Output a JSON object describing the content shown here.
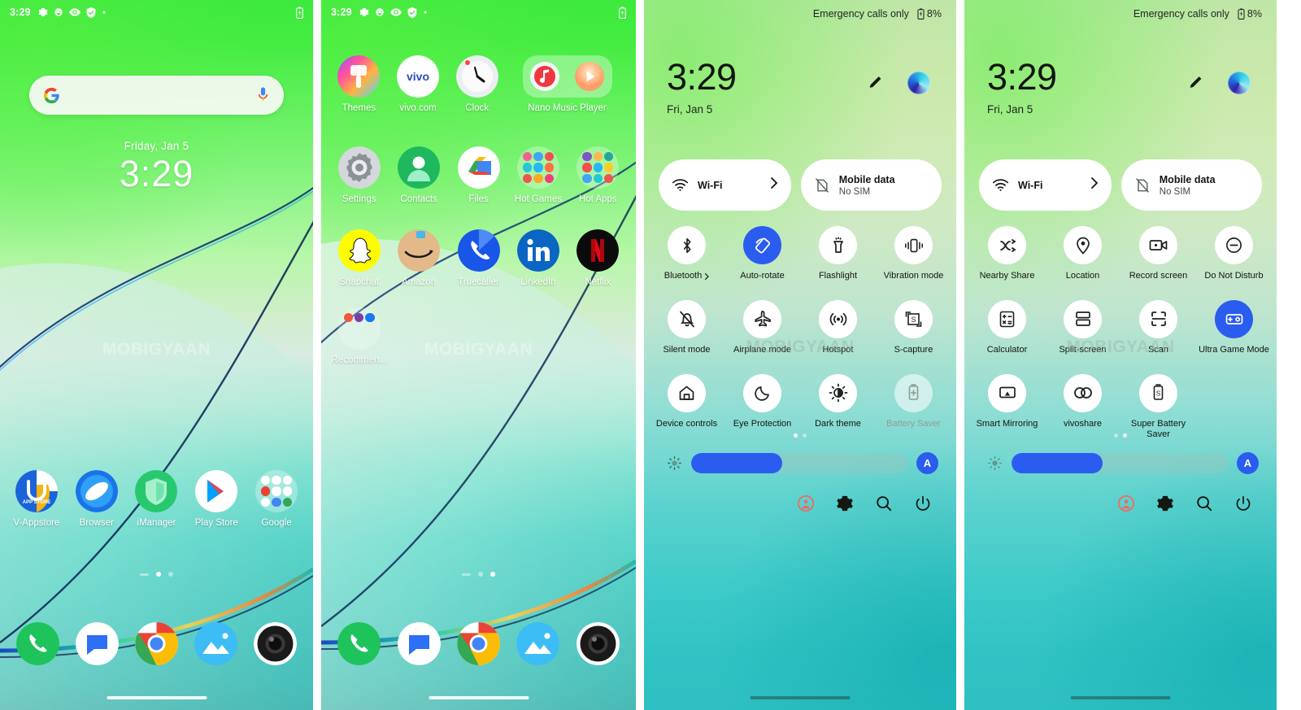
{
  "watermark": "MOBIGYAAN",
  "statusbar": {
    "time": "3:29",
    "icons": [
      "gear-icon",
      "face-icon",
      "eye-icon",
      "shield-icon",
      "dot-icon"
    ],
    "battery": "battery-charging-icon"
  },
  "home": {
    "search_placeholder": "",
    "google_icon": "google-g-icon",
    "mic_icon": "microphone-icon",
    "date": "Friday, Jan 5",
    "time": "3:29",
    "apps": [
      {
        "label": "V-Appstore",
        "icon": "v-appstore-icon"
      },
      {
        "label": "Browser",
        "icon": "browser-icon"
      },
      {
        "label": "iManager",
        "icon": "imanager-icon"
      },
      {
        "label": "Play Store",
        "icon": "play-store-icon"
      },
      {
        "label": "Google",
        "icon": "google-folder-icon"
      }
    ],
    "dock": [
      {
        "label": "Phone",
        "icon": "phone-icon"
      },
      {
        "label": "Messages",
        "icon": "messages-icon"
      },
      {
        "label": "Chrome",
        "icon": "chrome-icon"
      },
      {
        "label": "Gallery",
        "icon": "gallery-icon"
      },
      {
        "label": "Camera",
        "icon": "camera-icon"
      }
    ],
    "page_indicator": {
      "pages": 3,
      "active": 1
    }
  },
  "home2": {
    "row1": [
      {
        "label": "Themes",
        "icon": "themes-icon"
      },
      {
        "label": "vivo.com",
        "icon": "vivo-icon"
      },
      {
        "label": "Clock",
        "icon": "clock-icon"
      },
      {
        "label": "Nano Music Player",
        "icon": "nano-music-player-widget"
      }
    ],
    "row2": [
      {
        "label": "Settings",
        "icon": "settings-gear-icon"
      },
      {
        "label": "Contacts",
        "icon": "contacts-icon"
      },
      {
        "label": "Files",
        "icon": "files-icon"
      },
      {
        "label": "Hot Games",
        "icon": "hot-games-folder-icon"
      },
      {
        "label": "Hot Apps",
        "icon": "hot-apps-folder-icon"
      }
    ],
    "row3": [
      {
        "label": "Snapchat",
        "icon": "snapchat-icon"
      },
      {
        "label": "Amazon",
        "icon": "amazon-icon"
      },
      {
        "label": "Truecaller",
        "icon": "truecaller-icon"
      },
      {
        "label": "LinkedIn",
        "icon": "linkedin-icon"
      },
      {
        "label": "Netflix",
        "icon": "netflix-icon"
      }
    ],
    "row4": [
      {
        "label": "Recommen...",
        "icon": "recommendations-folder-icon"
      }
    ],
    "page_indicator": {
      "pages": 3,
      "active": 2
    }
  },
  "quicksettings": {
    "status_text": "Emergency calls only",
    "battery_percent": "8%",
    "time": "3:29",
    "date": "Fri, Jan 5",
    "edit_icon": "pencil-edit-icon",
    "avatar_icon": "user-avatar-icon",
    "pills": [
      {
        "title": "Wi-Fi",
        "sub": "",
        "icon": "wifi-icon",
        "chevron": true
      },
      {
        "title": "Mobile data",
        "sub": "No SIM",
        "icon": "no-sim-icon",
        "chevron": false
      }
    ],
    "page_one_tiles": [
      {
        "label": "Bluetooth",
        "icon": "bluetooth-icon",
        "state": "off",
        "chevron": true
      },
      {
        "label": "Auto-rotate",
        "icon": "auto-rotate-icon",
        "state": "on",
        "chevron": false
      },
      {
        "label": "Flashlight",
        "icon": "flashlight-icon",
        "state": "off",
        "chevron": false
      },
      {
        "label": "Vibration mode",
        "icon": "vibration-icon",
        "state": "off",
        "chevron": false
      },
      {
        "label": "Silent mode",
        "icon": "bell-off-icon",
        "state": "off",
        "chevron": false
      },
      {
        "label": "Airplane mode",
        "icon": "airplane-icon",
        "state": "off",
        "chevron": false
      },
      {
        "label": "Hotspot",
        "icon": "hotspot-icon",
        "state": "off",
        "chevron": false
      },
      {
        "label": "S-capture",
        "icon": "screen-capture-icon",
        "state": "off",
        "chevron": false
      },
      {
        "label": "Device controls",
        "icon": "home-controls-icon",
        "state": "off",
        "chevron": false
      },
      {
        "label": "Eye Protection",
        "icon": "moon-icon",
        "state": "off",
        "chevron": false
      },
      {
        "label": "Dark theme",
        "icon": "contrast-icon",
        "state": "off",
        "chevron": false
      },
      {
        "label": "Battery Saver",
        "icon": "battery-saver-icon",
        "state": "disabled",
        "chevron": false
      }
    ],
    "page_two_tiles": [
      {
        "label": "Nearby Share",
        "icon": "nearby-share-icon",
        "state": "off",
        "chevron": false
      },
      {
        "label": "Location",
        "icon": "location-pin-icon",
        "state": "off",
        "chevron": false
      },
      {
        "label": "Record screen",
        "icon": "record-screen-icon",
        "state": "off",
        "chevron": false
      },
      {
        "label": "Do Not Disturb",
        "icon": "do-not-disturb-icon",
        "state": "off",
        "chevron": false
      },
      {
        "label": "Calculator",
        "icon": "calculator-icon",
        "state": "off",
        "chevron": false
      },
      {
        "label": "Split-screen",
        "icon": "split-screen-icon",
        "state": "off",
        "chevron": false
      },
      {
        "label": "Scan",
        "icon": "scan-icon",
        "state": "off",
        "chevron": false
      },
      {
        "label": "Ultra Game Mode",
        "icon": "game-controller-icon",
        "state": "on",
        "chevron": false
      },
      {
        "label": "Smart Mirroring",
        "icon": "cast-screen-icon",
        "state": "off",
        "chevron": false
      },
      {
        "label": "vivoshare",
        "icon": "vivoshare-links-icon",
        "state": "off",
        "chevron": false
      },
      {
        "label": "Super Battery Saver",
        "icon": "super-battery-saver-icon",
        "state": "off",
        "chevron": false
      }
    ],
    "brightness": {
      "icon": "brightness-icon",
      "percent": 42,
      "auto_label": "A"
    },
    "footer": [
      {
        "icon": "user-account-icon",
        "color": "#ee6a62"
      },
      {
        "icon": "settings-gear-icon",
        "color": "#131813"
      },
      {
        "icon": "search-icon",
        "color": "#131813"
      },
      {
        "icon": "power-icon",
        "color": "#131813"
      }
    ],
    "page_dots": {
      "pages": 2,
      "active_page_one": 1,
      "active_page_two": 1
    }
  },
  "colors": {
    "accent_blue": "#2b5cf0",
    "wall_green": "#3ce93c",
    "wall_teal": "#0fa0a2",
    "tile_white": "#ffffff"
  }
}
